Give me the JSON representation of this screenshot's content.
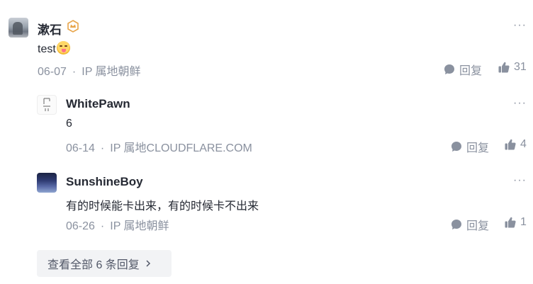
{
  "comment": {
    "author": "漱石",
    "text": "test",
    "emoji_icon": "yum-face-emoji",
    "date": "06-07",
    "ip": "IP 属地朝鲜",
    "reply_label": "回复",
    "likes": "31",
    "more_label": "···"
  },
  "replies": [
    {
      "author": "WhitePawn",
      "text": "6",
      "date": "06-14",
      "ip": "IP 属地CLOUDFLARE.COM",
      "reply_label": "回复",
      "likes": "4",
      "more_label": "···"
    },
    {
      "author": "SunshineBoy",
      "text": "有的时候能卡出来，有的时候卡不出来",
      "date": "06-26",
      "ip": "IP 属地朝鲜",
      "reply_label": "回复",
      "likes": "1",
      "more_label": "···"
    }
  ],
  "view_all_label": "查看全部 6 条回复",
  "separator": "·",
  "colors": {
    "text": "#252933",
    "meta": "#8a919f",
    "badge": "#e8a54b",
    "view_all_bg": "#f2f3f5"
  }
}
